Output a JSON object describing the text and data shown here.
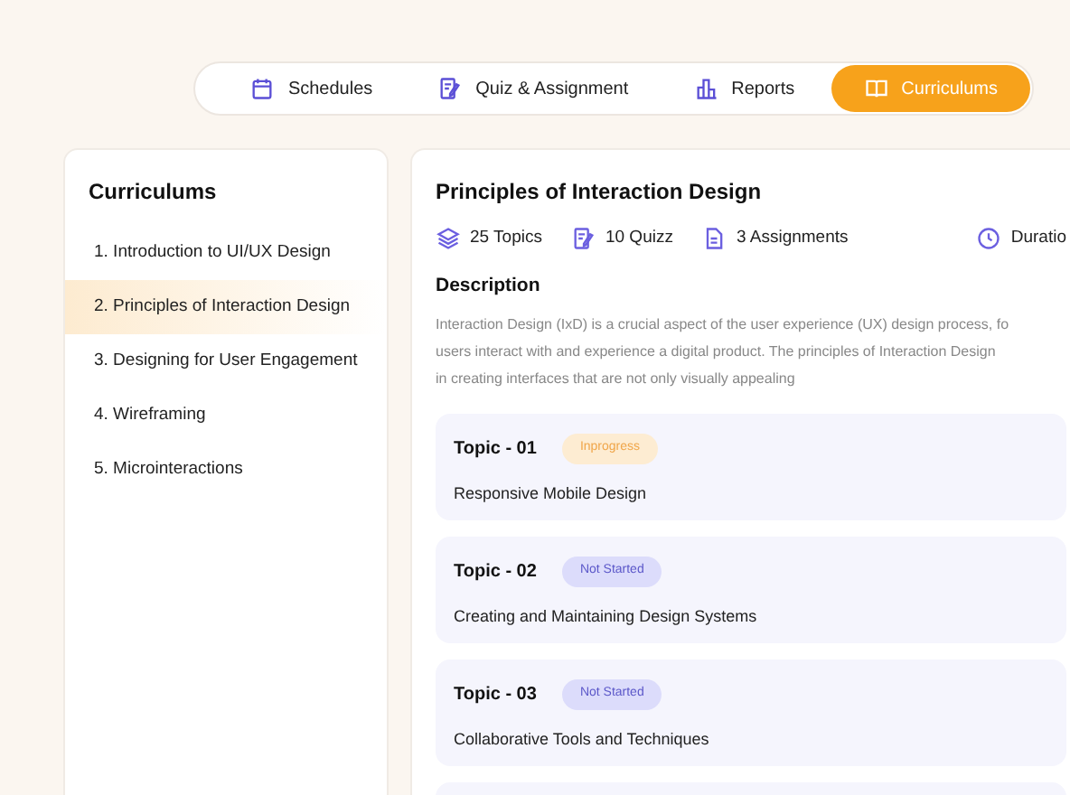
{
  "tabs": [
    {
      "label": "Schedules",
      "kind": "calendar",
      "selected": false
    },
    {
      "label": "Quiz & Assignment",
      "kind": "quiz",
      "selected": false
    },
    {
      "label": "Reports",
      "kind": "chart",
      "selected": false
    },
    {
      "label": "Curriculums",
      "kind": "book",
      "selected": true
    }
  ],
  "sidebar": {
    "title": "Curriculums",
    "items": [
      {
        "label": "1. Introduction to UI/UX Design",
        "selected": false
      },
      {
        "label": "2. Principles of Interaction Design",
        "selected": true
      },
      {
        "label": "3. Designing for User Engagement",
        "selected": false
      },
      {
        "label": "4. Wireframing",
        "selected": false
      },
      {
        "label": "5. Microinteractions",
        "selected": false
      }
    ]
  },
  "detail": {
    "title": "Principles of Interaction Design",
    "stats": [
      {
        "label": "25 Topics",
        "kind": "layers"
      },
      {
        "label": "10 Quizz",
        "kind": "quiz"
      },
      {
        "label": "3 Assignments",
        "kind": "doc"
      }
    ],
    "duration": "Duratio",
    "description_heading": "Description",
    "description_lines": [
      "Interaction Design (IxD) is a crucial aspect of the user experience (UX) design process, fo",
      "users interact with and experience a digital product. The principles of Interaction Design",
      "in creating interfaces that are not only visually appealing"
    ],
    "topics": [
      {
        "title": "Topic - 01",
        "status": "Inprogress",
        "kind": "in_progress",
        "name": "Responsive Mobile Design"
      },
      {
        "title": "Topic - 02",
        "status": "Not Started",
        "kind": "not_started",
        "name": "Creating and Maintaining Design Systems"
      },
      {
        "title": "Topic - 03",
        "status": "Not Started",
        "kind": "not_started",
        "name": "Collaborative Tools and Techniques"
      }
    ]
  }
}
